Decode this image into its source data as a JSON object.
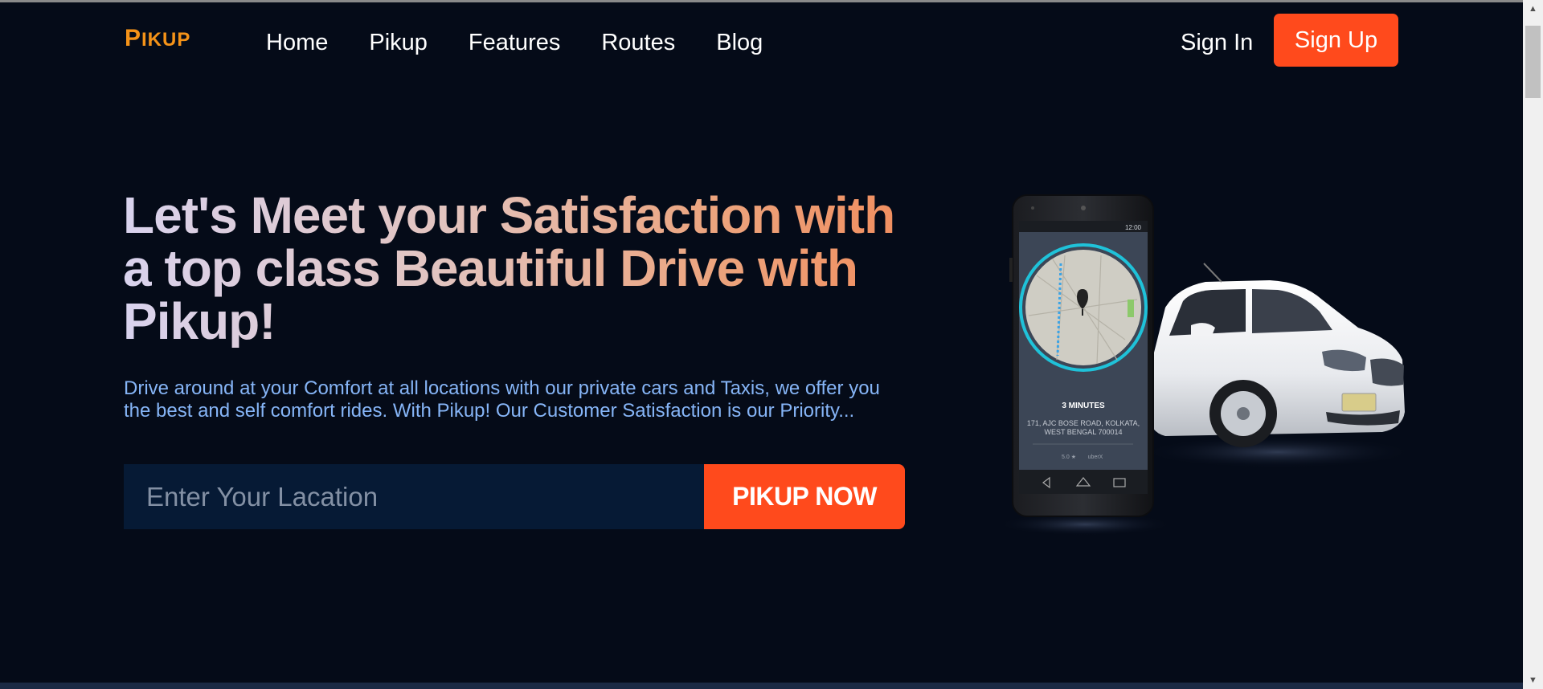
{
  "nav": {
    "logo": "Pikup",
    "links": [
      "Home",
      "Pikup",
      "Features",
      "Routes",
      "Blog"
    ],
    "sign_in": "Sign In",
    "sign_up": "Sign Up"
  },
  "hero": {
    "title": "Let's Meet your Satisfaction with a top class Beautiful Drive with Pikup!",
    "description": "Drive around at your Comfort at all locations with our private cars and Taxis, we offer you the best and self comfort rides. With Pikup! Our Customer Satisfaction is our Priority...",
    "search_placeholder": "Enter Your Lacation",
    "cta": "PIKUP NOW"
  },
  "phone": {
    "time": "12:00",
    "eta": "3 MINUTES",
    "address_line1": "171, AJC BOSE ROAD, KOLKATA,",
    "address_line2": "WEST BENGAL 700014",
    "rating": "5.0 ★",
    "service": "uberX"
  },
  "colors": {
    "background": "#050b18",
    "accent": "#ff4a1c",
    "logo": "#f59318",
    "description": "#86b5f7",
    "input_bg": "#061a35"
  }
}
